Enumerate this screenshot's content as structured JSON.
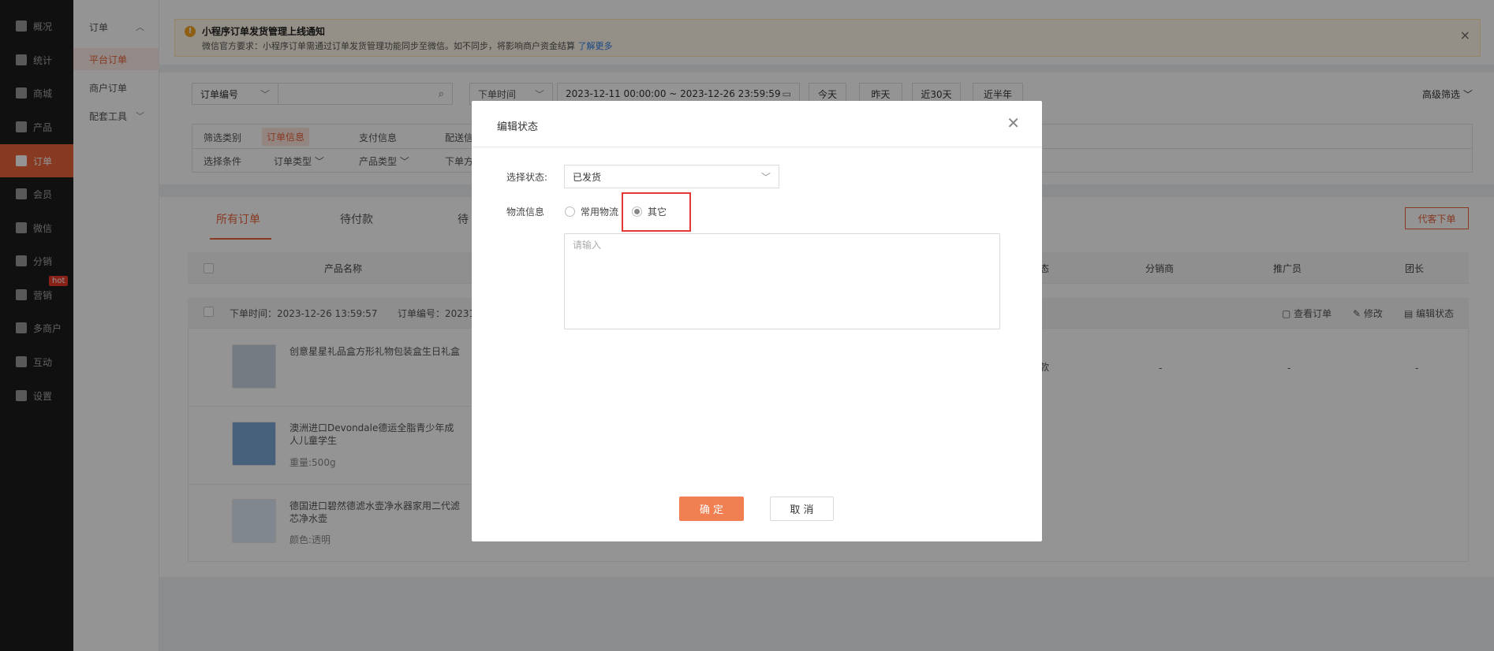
{
  "nav": {
    "items": [
      {
        "label": "概况",
        "icon": "layers-icon"
      },
      {
        "label": "统计",
        "icon": "chart-icon"
      },
      {
        "label": "商城",
        "icon": "shop-icon"
      },
      {
        "label": "产品",
        "icon": "grid-icon"
      },
      {
        "label": "订单",
        "icon": "clipboard-icon"
      },
      {
        "label": "会员",
        "icon": "crown-icon"
      },
      {
        "label": "微信",
        "icon": "wechat-icon"
      },
      {
        "label": "分销",
        "icon": "users-icon"
      },
      {
        "label": "营销",
        "icon": "flag-icon"
      },
      {
        "label": "多商户",
        "icon": "store-icon"
      },
      {
        "label": "互动",
        "icon": "apps-icon"
      },
      {
        "label": "设置",
        "icon": "gear-icon"
      }
    ],
    "hot_badge": "hot",
    "active_color": "#e8623a"
  },
  "subnav": {
    "group": "订单",
    "items": [
      "平台订单",
      "商户订单",
      "配套工具"
    ]
  },
  "notice": {
    "title": "小程序订单发货管理上线通知",
    "desc": "微信官方要求：小程序订单需通过订单发货管理功能同步至微信。如不同步，将影响商户资金结算",
    "link": "了解更多",
    "close": "×"
  },
  "search": {
    "type_select": "订单编号",
    "time_select": "下单时间",
    "date_range": "2023-12-11 00:00:00 ~ 2023-12-26 23:59:59",
    "quick": [
      "今天",
      "昨天",
      "近30天",
      "近半年"
    ],
    "advanced": "高级筛选"
  },
  "filter": {
    "row1_label": "筛选类别",
    "row1_items": [
      "订单信息",
      "支付信息",
      "配送信"
    ],
    "row2_label": "选择条件",
    "row2_items": [
      "订单类型",
      "产品类型",
      "下单方"
    ]
  },
  "tabs": [
    "所有订单",
    "待付款",
    "待"
  ],
  "agent_order": "代客下单",
  "table": {
    "headers": [
      "产品名称",
      "态",
      "分销商",
      "推广员",
      "团长"
    ],
    "order_time_label": "下单时间：2023-12-26 13:59:57",
    "order_no_label": "订单编号：20231",
    "actions": [
      "查看订单",
      "修改",
      "编辑状态"
    ],
    "products": [
      {
        "name": "创意星星礼品盒方形礼物包装盒生日礼盒",
        "spec": ""
      },
      {
        "name": "澳洲进口Devondale德运全脂青少年成人儿童学生",
        "spec": "重量:500g"
      },
      {
        "name": "德国进口碧然德滤水壶净水器家用二代滤芯净水壶",
        "spec": "颜色:透明"
      }
    ],
    "row_status": "款",
    "dash": "-"
  },
  "modal": {
    "title": "编辑状态",
    "status_label": "选择状态:",
    "status_value": "已发货",
    "logistics_label": "物流信息",
    "radio_common": "常用物流",
    "radio_other": "其它",
    "textarea_placeholder": "请输入",
    "confirm": "确 定",
    "cancel": "取 消"
  }
}
